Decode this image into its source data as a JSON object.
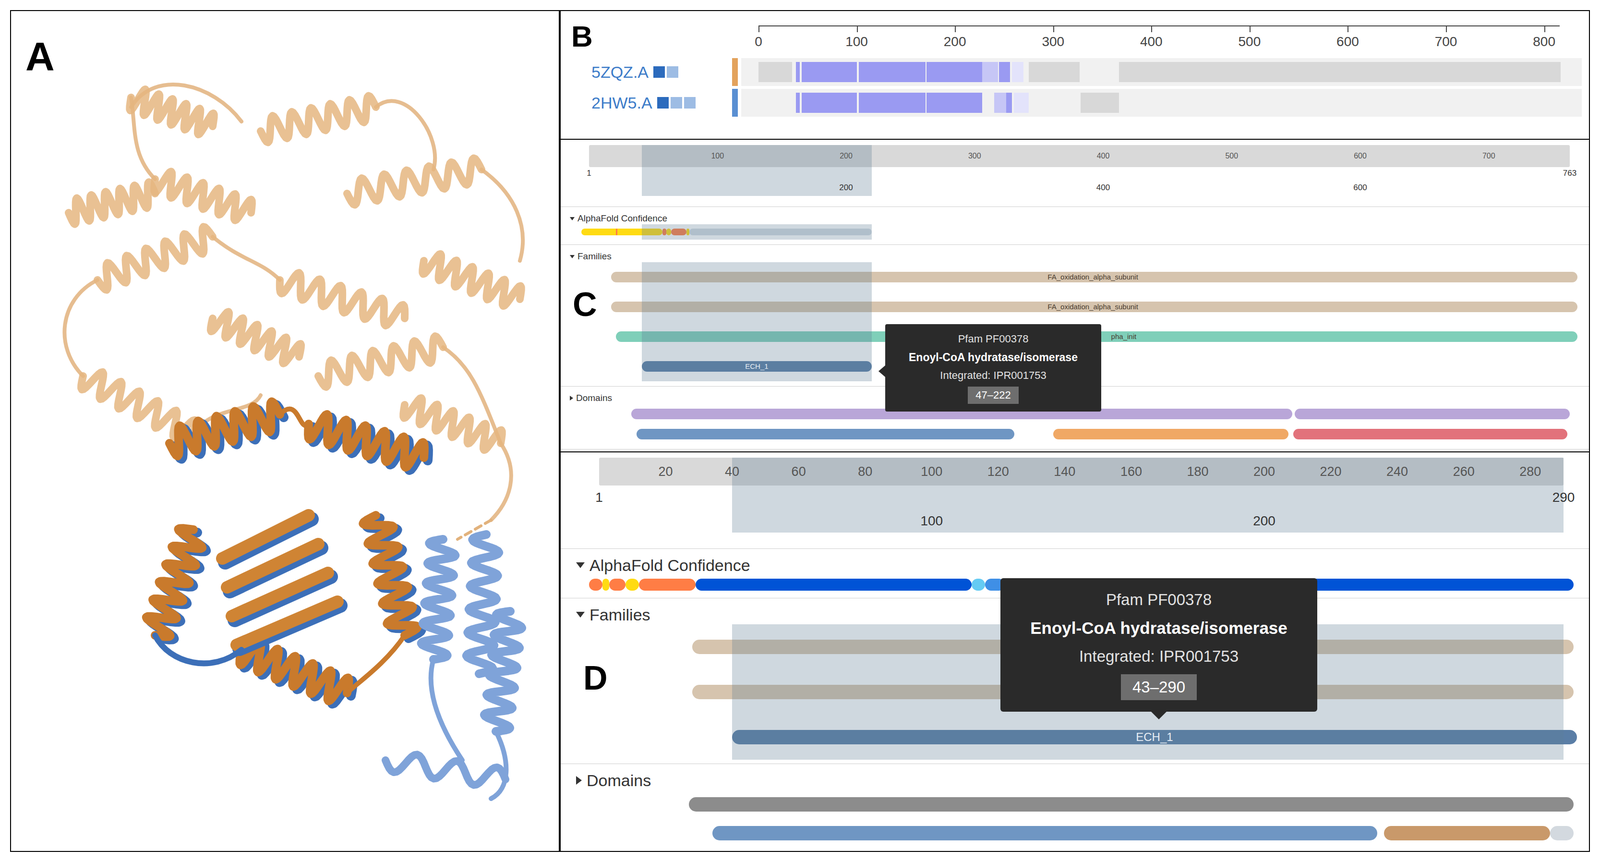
{
  "figure": {
    "panel_a": {
      "label": "A"
    },
    "panel_b": {
      "label": "B",
      "scale_max": 830,
      "line_end": 816,
      "ticks": [
        {
          "value": 0,
          "label": "0"
        },
        {
          "value": 100,
          "label": "100"
        },
        {
          "value": 200,
          "label": "200"
        },
        {
          "value": 300,
          "label": "300"
        },
        {
          "value": 400,
          "label": "400"
        },
        {
          "value": 500,
          "label": "500"
        },
        {
          "value": 600,
          "label": "600"
        },
        {
          "value": 700,
          "label": "700"
        },
        {
          "value": 800,
          "label": "800"
        }
      ],
      "rows": [
        {
          "name": "5ZQZ.A",
          "chips": [
            "#2c6bbd",
            "#9dbce4"
          ],
          "stripe": "#e3a25c",
          "segments": [
            {
              "start": 0,
              "end": 34,
              "kind": "gap"
            },
            {
              "start": 38,
              "end": 42,
              "kind": "aligned"
            },
            {
              "start": 44,
              "end": 100,
              "kind": "aligned"
            },
            {
              "start": 102,
              "end": 170,
              "kind": "aligned"
            },
            {
              "start": 171,
              "end": 228,
              "kind": "aligned"
            },
            {
              "start": 228,
              "end": 244,
              "kind": "partial"
            },
            {
              "start": 245,
              "end": 256,
              "kind": "aligned"
            },
            {
              "start": 258,
              "end": 270,
              "kind": "faint"
            },
            {
              "start": 275,
              "end": 327,
              "kind": "gap"
            },
            {
              "start": 367,
              "end": 817,
              "kind": "gap"
            }
          ]
        },
        {
          "name": "2HW5.A",
          "chips": [
            "#2c6bbd",
            "#9dbce4",
            "#9dbce4"
          ],
          "stripe": "#5a8fd2",
          "segments": [
            {
              "start": 38,
              "end": 42,
              "kind": "aligned"
            },
            {
              "start": 44,
              "end": 100,
              "kind": "aligned"
            },
            {
              "start": 102,
              "end": 170,
              "kind": "aligned"
            },
            {
              "start": 171,
              "end": 228,
              "kind": "aligned"
            },
            {
              "start": 240,
              "end": 252,
              "kind": "partial"
            },
            {
              "start": 252,
              "end": 258,
              "kind": "aligned"
            },
            {
              "start": 260,
              "end": 275,
              "kind": "faint"
            },
            {
              "start": 328,
              "end": 367,
              "kind": "gap"
            }
          ]
        }
      ]
    },
    "panel_c": {
      "label": "C",
      "length": 763,
      "selection": {
        "start": 41,
        "end": 220
      },
      "ruler": {
        "ticks_top": [
          {
            "value": 100,
            "label": "100"
          },
          {
            "value": 200,
            "label": "200"
          },
          {
            "value": 300,
            "label": "300"
          },
          {
            "value": 400,
            "label": "400"
          },
          {
            "value": 500,
            "label": "500"
          },
          {
            "value": 600,
            "label": "600"
          },
          {
            "value": 700,
            "label": "700"
          }
        ],
        "start": "1",
        "end": "763",
        "ticks_bottom": [
          {
            "value": 200,
            "label": "200"
          },
          {
            "value": 400,
            "label": "400"
          },
          {
            "value": 600,
            "label": "600"
          }
        ]
      },
      "tracks": [
        {
          "title": "AlphaFold Confidence",
          "expanded": true,
          "kind": "confidence",
          "shaded": true,
          "segments": [
            {
              "start": -6,
              "end": 57,
              "color": "#ffdb13"
            },
            {
              "start": 21,
              "end": 22,
              "color": "#ff7d45"
            },
            {
              "start": 57,
              "end": 60,
              "color": "#ff7d45"
            },
            {
              "start": 60,
              "end": 64,
              "color": "#ffdb13"
            },
            {
              "start": 64,
              "end": 76,
              "color": "#ff7d45"
            },
            {
              "start": 76,
              "end": 78,
              "color": "#ffdb13"
            },
            {
              "start": 78,
              "end": 220,
              "color": "#d3dbe3"
            }
          ]
        },
        {
          "title": "Families",
          "expanded": true,
          "kind": "bars",
          "shaded": true,
          "rows": [
            {
              "segments": [
                {
                  "start": 17,
                  "end": 769,
                  "color": "#d6c4ae",
                  "label": "FA_oxidation_alpha_subunit",
                  "label_at": 392
                }
              ]
            },
            {
              "segments": [
                {
                  "start": 17,
                  "end": 769,
                  "color": "#d6c4ae",
                  "label": "FA_oxidation_alpha_subunit",
                  "label_at": 392
                }
              ]
            },
            {
              "segments": [
                {
                  "start": 21,
                  "end": 769,
                  "color": "#7fcfb9",
                  "label": "pha_init",
                  "label_at": 416
                }
              ]
            },
            {
              "segments": [
                {
                  "start": 41,
                  "end": 220,
                  "color": "#5a7ea6",
                  "label": "ECH_1"
                }
              ]
            }
          ]
        },
        {
          "title": "Domains",
          "expanded": false,
          "kind": "bars",
          "shaded": false,
          "rows": [
            {
              "segments": [
                {
                  "start": 33,
                  "end": 547,
                  "color": "#b9a6d8"
                },
                {
                  "start": 549,
                  "end": 763,
                  "color": "#b9a6d8"
                }
              ]
            },
            {
              "segments": [
                {
                  "start": 37,
                  "end": 331,
                  "color": "#6f96c3"
                },
                {
                  "start": 361,
                  "end": 544,
                  "color": "#f0a865"
                },
                {
                  "start": 548,
                  "end": 761,
                  "color": "#e2727b"
                }
              ]
            }
          ]
        }
      ],
      "tooltip": {
        "source": "Pfam PF00378",
        "name": "Enoyl-CoA hydratase/isomerase",
        "integrated": "Integrated: IPR001753",
        "range": "47–222"
      }
    },
    "panel_d": {
      "label": "D",
      "length": 290,
      "selection": {
        "start": 40,
        "end": 290
      },
      "ruler": {
        "ticks_top": [
          {
            "value": 20,
            "label": "20"
          },
          {
            "value": 40,
            "label": "40"
          },
          {
            "value": 60,
            "label": "60"
          },
          {
            "value": 80,
            "label": "80"
          },
          {
            "value": 100,
            "label": "100"
          },
          {
            "value": 120,
            "label": "120"
          },
          {
            "value": 140,
            "label": "140"
          },
          {
            "value": 160,
            "label": "160"
          },
          {
            "value": 180,
            "label": "180"
          },
          {
            "value": 200,
            "label": "200"
          },
          {
            "value": 220,
            "label": "220"
          },
          {
            "value": 240,
            "label": "240"
          },
          {
            "value": 260,
            "label": "260"
          },
          {
            "value": 280,
            "label": "280"
          }
        ],
        "start": "1",
        "end": "290",
        "ticks_bottom": [
          {
            "value": 100,
            "label": "100"
          },
          {
            "value": 200,
            "label": "200"
          }
        ]
      },
      "tracks": [
        {
          "title": "AlphaFold Confidence",
          "expanded": true,
          "kind": "confidence",
          "shaded": false,
          "segments": [
            {
              "start": -3,
              "end": 1,
              "color": "#ff7d45"
            },
            {
              "start": 1,
              "end": 3,
              "color": "#ffdb13"
            },
            {
              "start": 3,
              "end": 8,
              "color": "#ff7d45"
            },
            {
              "start": 8,
              "end": 12,
              "color": "#ffdb13"
            },
            {
              "start": 12,
              "end": 29,
              "color": "#ff7d45"
            },
            {
              "start": 29,
              "end": 112,
              "color": "#0053d6"
            },
            {
              "start": 112,
              "end": 116,
              "color": "#65cbf3"
            },
            {
              "start": 116,
              "end": 122,
              "color": "#3f8fe6"
            },
            {
              "start": 122,
              "end": 293,
              "color": "#0053d6"
            }
          ]
        },
        {
          "title": "Families",
          "expanded": true,
          "kind": "bars",
          "shaded": true,
          "rows": [
            {
              "segments": [
                {
                  "start": 28,
                  "end": 293,
                  "color": "#d6c4ae"
                }
              ]
            },
            {
              "segments": [
                {
                  "start": 28,
                  "end": 293,
                  "color": "#d6c4ae"
                }
              ]
            },
            {
              "segments": [
                {
                  "start": 40,
                  "end": 294,
                  "color": "#5a7ea6",
                  "label": "ECH_1"
                }
              ]
            }
          ]
        },
        {
          "title": "Domains",
          "expanded": false,
          "kind": "bars",
          "shaded": false,
          "rows": [
            {
              "segments": [
                {
                  "start": 27,
                  "end": 293,
                  "color": "#8c8c8c"
                }
              ]
            },
            {
              "segments": [
                {
                  "start": 34,
                  "end": 234,
                  "color": "#6f96c3"
                },
                {
                  "start": 236,
                  "end": 286,
                  "color": "#c9996a"
                },
                {
                  "start": 286,
                  "end": 293,
                  "color": "#d3d9df"
                }
              ]
            }
          ]
        }
      ],
      "tooltip": {
        "source": "Pfam PF00378",
        "name": "Enoyl-CoA hydratase/isomerase",
        "integrated": "Integrated: IPR001753",
        "range": "43–290"
      }
    }
  }
}
